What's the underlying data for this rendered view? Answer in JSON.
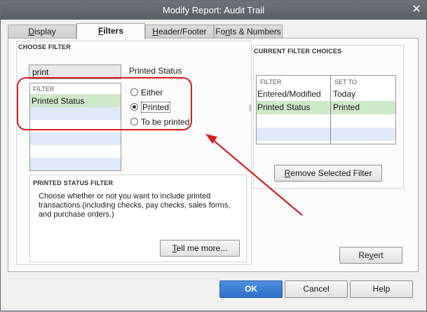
{
  "window": {
    "title": "Modify Report: Audit Trail",
    "close_glyph": "✕"
  },
  "tabs": [
    {
      "label": "Display",
      "mnemonic": "D",
      "rest": "isplay",
      "active": false
    },
    {
      "label": "Filters",
      "mnemonic": "F",
      "rest": "ilters",
      "active": true
    },
    {
      "label": "Header/Footer",
      "mnemonic": "H",
      "rest": "eader/Footer",
      "active": false
    },
    {
      "label": "Fonts & Numbers",
      "pre": "Fo",
      "mnemonic": "n",
      "rest": "ts & Numbers",
      "active": false
    }
  ],
  "choose_filter": {
    "caption": "CHOOSE FILTER",
    "search_value": "print",
    "current_filter": "Printed Status",
    "list_header": "FILTER",
    "list_items": [
      "Printed Status"
    ],
    "options": [
      {
        "label": "Either",
        "checked": false
      },
      {
        "label": "Printed",
        "checked": true
      },
      {
        "label": "To be printed",
        "checked": false
      }
    ]
  },
  "status_filter": {
    "caption": "PRINTED STATUS FILTER",
    "description": "Choose whether or not you want to include printed transactions (including checks, pay checks, sales forms, and purchase orders.)",
    "tell_me_more": {
      "mnemonic": "T",
      "rest": "ell me more..."
    }
  },
  "current_choices": {
    "caption": "CURRENT FILTER CHOICES",
    "col_filter": "FILTER",
    "col_set_to": "SET TO",
    "rows": [
      {
        "filter": "Entered/Modified",
        "set_to": "Today"
      },
      {
        "filter": "Printed Status",
        "set_to": "Printed"
      }
    ],
    "remove_button": {
      "mnemonic": "R",
      "rest": "emove Selected Filter"
    }
  },
  "buttons": {
    "revert": {
      "pre": "Re",
      "mnemonic": "v",
      "rest": "ert"
    },
    "ok": "OK",
    "cancel": "Cancel",
    "help": "Help"
  },
  "colors": {
    "annotation_red": "#d42020",
    "ok_blue": "#2e6fc9",
    "selected_row": "#cfe8c9",
    "alt_row": "#dfe9f7"
  }
}
